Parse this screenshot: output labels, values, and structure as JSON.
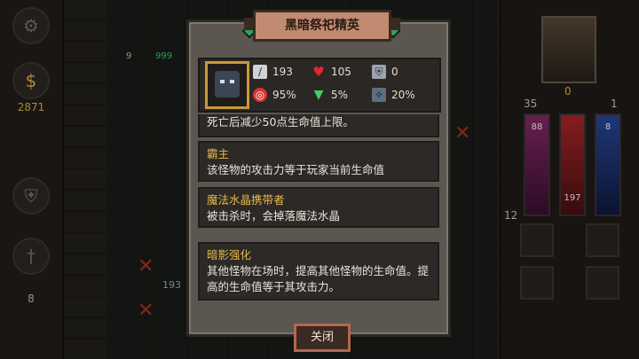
{
  "hud": {
    "left_gold": "2871",
    "left_count": "8",
    "left_slot_num": "9",
    "left_slot_hp": "999",
    "grid_number": "193",
    "right_stat_left": "35",
    "right_stat_center": "0",
    "right_stat_right": "1",
    "right_bar_purple": "88",
    "right_bar_blue": "8",
    "right_bar_red": "197",
    "right_level": "12"
  },
  "dialog": {
    "title": "黑暗祭祀精英",
    "stats": {
      "attack": "193",
      "health": "105",
      "defense": "0",
      "hit": "95%",
      "drop": "5%",
      "crit": "20%"
    },
    "abilities": [
      {
        "name": "",
        "desc": "死亡后减少50点生命值上限。"
      },
      {
        "name": "霸主",
        "desc": "该怪物的攻击力等于玩家当前生命值"
      },
      {
        "name": "魔法水晶携带者",
        "desc": "被击杀时，会掉落魔法水晶"
      },
      {
        "name": "暗影强化",
        "desc": "其他怪物在场时，提高其他怪物的生命值。提高的生命值等于其攻击力。"
      }
    ],
    "close_label": "关闭"
  },
  "icons": [
    "gear-icon",
    "coin-icon",
    "sword-icon",
    "heart-icon",
    "shield-icon",
    "target-icon",
    "potion-icon",
    "crit-icon"
  ]
}
